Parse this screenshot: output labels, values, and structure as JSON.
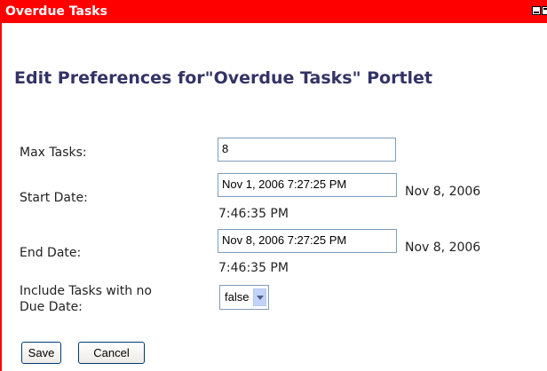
{
  "portlet": {
    "title": "Overdue Tasks"
  },
  "form": {
    "heading": "Edit Preferences for\"Overdue Tasks\" Portlet",
    "max_tasks": {
      "label": "Max Tasks:",
      "value": "8"
    },
    "start_date": {
      "label": "Start Date:",
      "value": "Nov 1, 2006 7:27:25 PM",
      "current_date": "Nov 8, 2006",
      "current_time": "7:46:35 PM"
    },
    "end_date": {
      "label": "End Date:",
      "value": "Nov 8, 2006 7:27:25 PM",
      "current_date": "Nov 8, 2006",
      "current_time": "7:46:35 PM"
    },
    "include_no_due": {
      "label_line1": "Include Tasks with no",
      "label_line2": "Due Date:",
      "value": "false"
    },
    "save_label": "Save",
    "cancel_label": "Cancel"
  },
  "colors": {
    "titlebar": "#ff0000",
    "heading": "#333366",
    "input_border": "#7f9db9"
  },
  "icons": [
    "minimize-icon",
    "maximize-icon",
    "chevron-down-icon"
  ]
}
